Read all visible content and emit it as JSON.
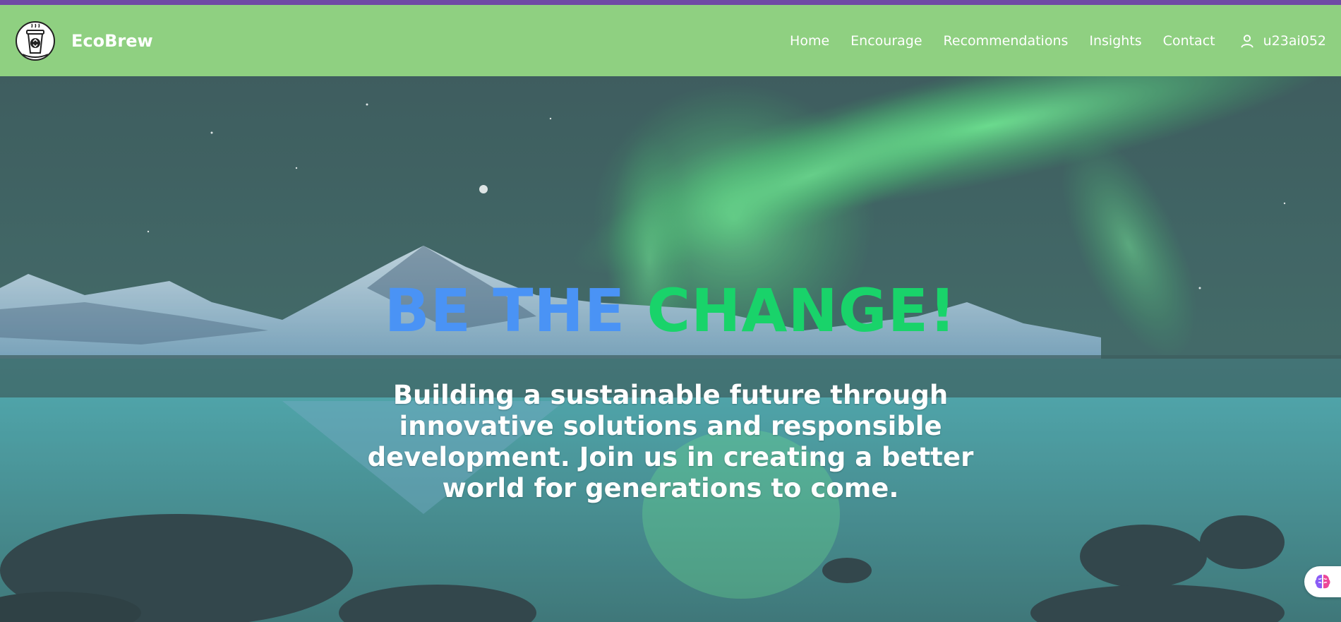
{
  "colors": {
    "top_strip": "#6f4aa6",
    "navbar": "#8fd081",
    "headline_part_a": "#4a93f5",
    "headline_part_b": "#19d36a"
  },
  "brand": {
    "name": "EcoBrew",
    "logo_icon": "coffee-cup-recycle-icon"
  },
  "nav": {
    "links": [
      "Home",
      "Encourage",
      "Recommendations",
      "Insights",
      "Contact"
    ],
    "user": {
      "icon": "user-icon",
      "username": "u23ai052"
    }
  },
  "hero": {
    "headline_part_a": "BE THE",
    "headline_part_b": "CHANGE!",
    "tagline": "Building a sustainable future through innovative solutions and responsible development. Join us in creating a better world for generations to come."
  },
  "assistant": {
    "icon": "brain-icon"
  }
}
